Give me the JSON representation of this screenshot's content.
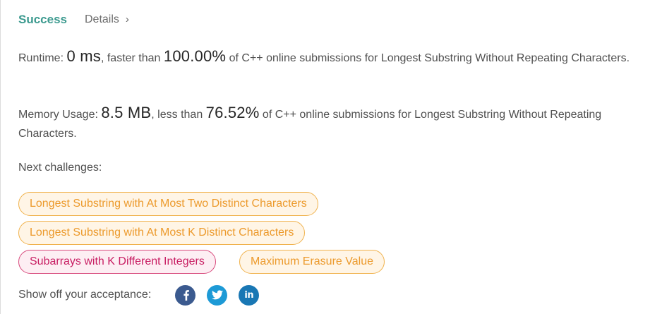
{
  "status": {
    "result_label": "Success",
    "details_label": "Details",
    "details_chevron": "›"
  },
  "runtime": {
    "label": "Runtime: ",
    "value": "0 ms",
    "comparison": ", faster than ",
    "percent": "100.00%",
    "suffix": " of C++ online submissions for Longest Substring Without Repeating Characters."
  },
  "memory": {
    "label": "Memory Usage: ",
    "value": "8.5 MB",
    "comparison": ", less than ",
    "percent": "76.52%",
    "suffix": " of C++ online submissions for Longest Substring Without Repeating Characters."
  },
  "next_challenges": {
    "label": "Next challenges:",
    "items": [
      {
        "title": "Longest Substring with At Most Two Distinct Characters",
        "difficulty": "medium"
      },
      {
        "title": "Longest Substring with At Most K Distinct Characters",
        "difficulty": "medium"
      },
      {
        "title": "Subarrays with K Different Integers",
        "difficulty": "hard"
      },
      {
        "title": "Maximum Erasure Value",
        "difficulty": "medium"
      }
    ]
  },
  "share": {
    "label": "Show off your acceptance:",
    "icons": [
      "facebook-icon",
      "twitter-icon",
      "linkedin-icon"
    ],
    "linkedin_text": "in"
  },
  "colors": {
    "success": "#3c9a8f",
    "medium_border": "#f0b24d",
    "medium_text": "#ec9a2c",
    "hard_border": "#d84a7d",
    "hard_text": "#c81e63",
    "facebook": "#3b5a8f",
    "twitter": "#1d9ad6",
    "linkedin": "#1977b4"
  }
}
